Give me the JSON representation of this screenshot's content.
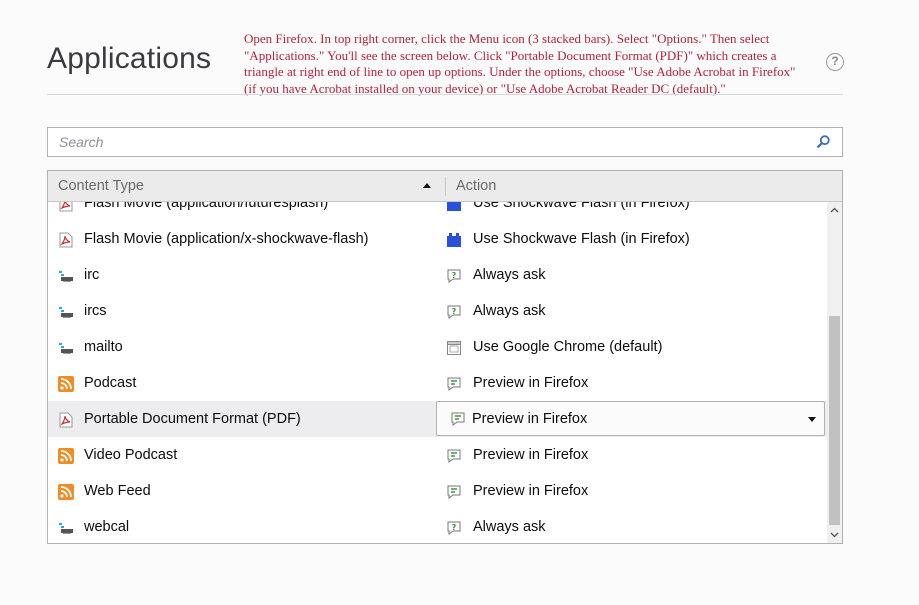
{
  "page": {
    "title": "Applications",
    "instructions": "Open Firefox. In top right corner, click the Menu icon (3 stacked bars). Select \"Options.\" Then select \"Applications.\"  You'll see the screen below. Click \"Portable Document Format (PDF)\" which creates a triangle at right end of line to open up options. Under the options, choose \"Use Adobe Acrobat in Firefox\" (if you have Acrobat installed on your device) or \"Use Adobe Acrobat Reader DC (default).\"",
    "help_symbol": "?"
  },
  "search": {
    "placeholder": "Search",
    "value": ""
  },
  "table": {
    "header": {
      "content_type": "Content Type",
      "action": "Action"
    },
    "rows": [
      {
        "type": "Flash Movie (application/futuresplash)",
        "type_icon": "pdf-icon",
        "action": "Use Shockwave Flash (in Firefox)",
        "action_icon": "plugin-icon"
      },
      {
        "type": "Flash Movie (application/x-shockwave-flash)",
        "type_icon": "pdf-icon",
        "action": "Use Shockwave Flash (in Firefox)",
        "action_icon": "plugin-icon"
      },
      {
        "type": "irc",
        "type_icon": "protocol-icon",
        "action": "Always ask",
        "action_icon": "ask-icon"
      },
      {
        "type": "ircs",
        "type_icon": "protocol-icon",
        "action": "Always ask",
        "action_icon": "ask-icon"
      },
      {
        "type": "mailto",
        "type_icon": "protocol-icon",
        "action": "Use Google Chrome (default)",
        "action_icon": "application-icon"
      },
      {
        "type": "Podcast",
        "type_icon": "feed-icon",
        "action": "Preview in Firefox",
        "action_icon": "preview-icon"
      },
      {
        "type": "Portable Document Format (PDF)",
        "type_icon": "pdf-icon",
        "action": "Preview in Firefox",
        "action_icon": "preview-icon"
      },
      {
        "type": "Video Podcast",
        "type_icon": "feed-icon",
        "action": "Preview in Firefox",
        "action_icon": "preview-icon"
      },
      {
        "type": "Web Feed",
        "type_icon": "feed-icon",
        "action": "Preview in Firefox",
        "action_icon": "preview-icon"
      },
      {
        "type": "webcal",
        "type_icon": "protocol-icon",
        "action": "Always ask",
        "action_icon": "ask-icon"
      }
    ]
  },
  "colors": {
    "instructions_text": "#b3233a",
    "selected_row": "#ededf0",
    "feed_orange": "#f28c25",
    "pdf_red": "#d0312d",
    "plugin_blue": "#2a4fd8",
    "preview_green": "#3a9a3a"
  }
}
